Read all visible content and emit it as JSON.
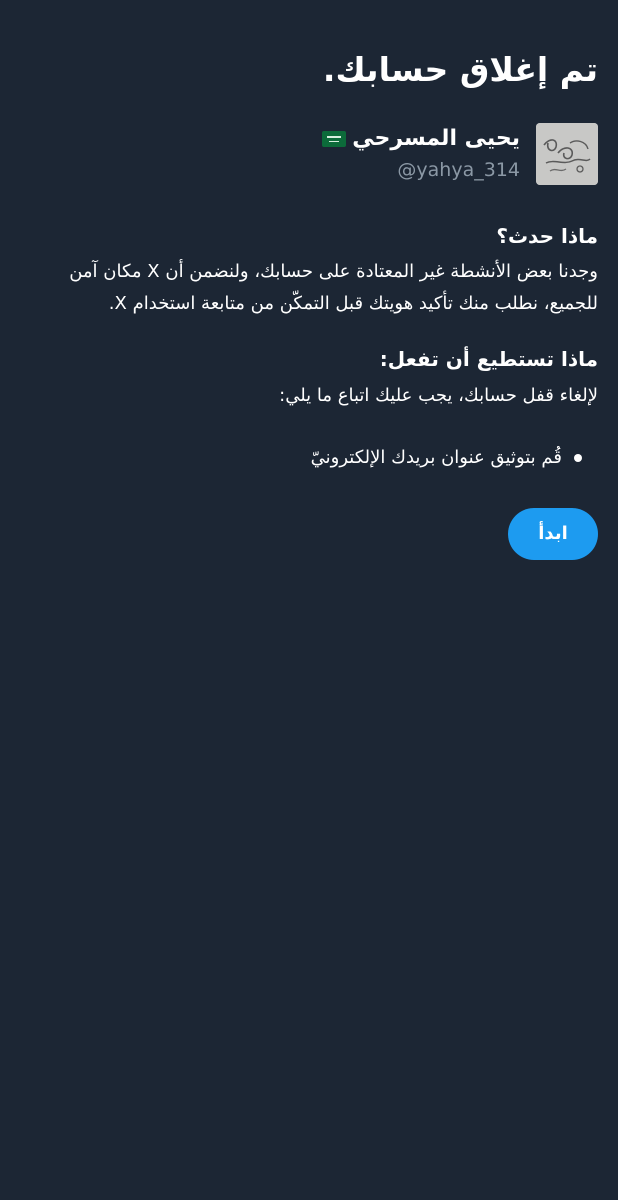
{
  "header": {
    "title": "تم إغلاق حسابك."
  },
  "account": {
    "display_name": "يحيى المسرحي",
    "flag_icon": "saudi-flag-icon",
    "handle": "@yahya_314",
    "avatar_icon": "avatar-image"
  },
  "what_happened": {
    "heading": "ماذا حدث؟",
    "text": "وجدنا بعض الأنشطة غير المعتادة على حسابك، ولنضمن أن X مكان آمن للجميع، نطلب منك تأكيد هويتك قبل التمكّن من متابعة استخدام X."
  },
  "what_to_do": {
    "heading": "ماذا تستطيع أن تفعل:",
    "intro": "لإلغاء قفل حسابك، يجب عليك اتباع ما يلي:",
    "steps": [
      "قُم بتوثيق عنوان بريدك الإلكترونيّ"
    ]
  },
  "actions": {
    "start_label": "ابدأ"
  },
  "colors": {
    "background": "#1c2634",
    "text": "#ffffff",
    "secondary_text": "#8b98a5",
    "accent": "#1d9bf0"
  }
}
